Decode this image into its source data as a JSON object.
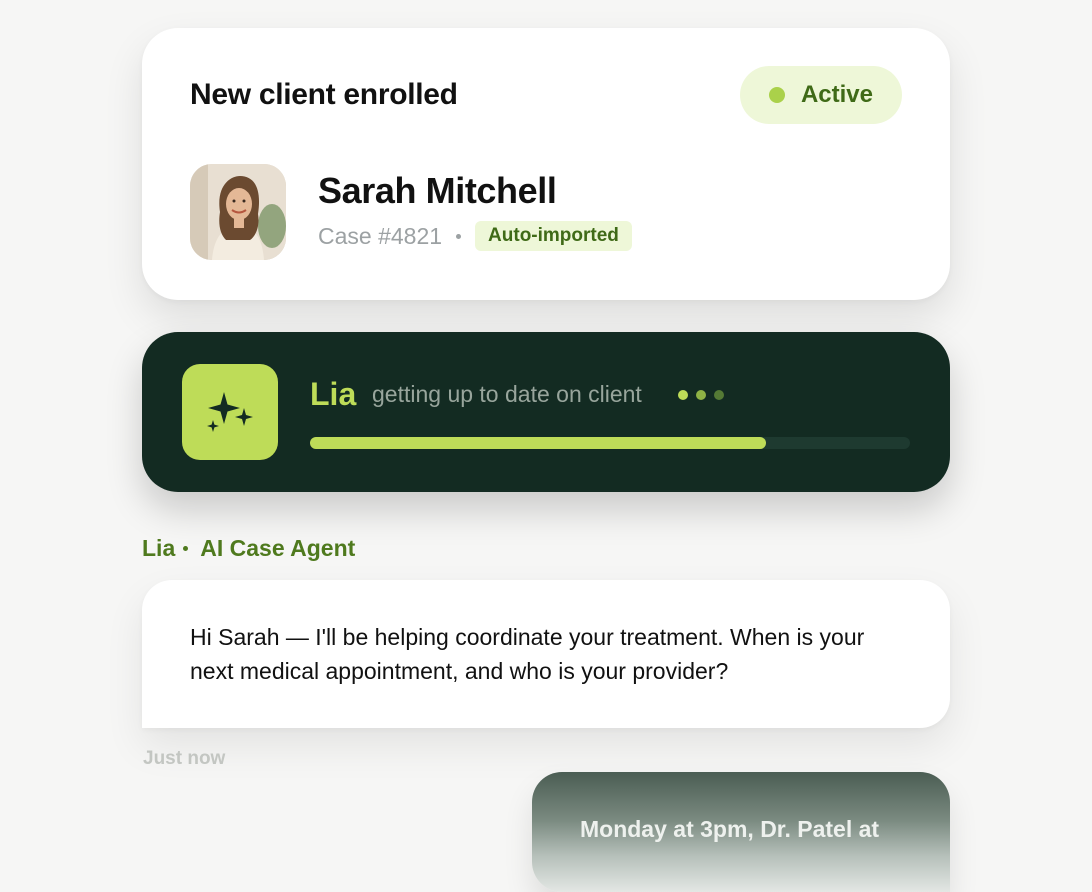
{
  "enrollment": {
    "title": "New client enrolled",
    "status_label": "Active",
    "status_color": "#aad14a"
  },
  "client": {
    "name": "Sarah Mitchell",
    "case_number": "Case #4821",
    "badge": "Auto-imported",
    "avatar_icon": "avatar-photo"
  },
  "agent": {
    "name": "Lia",
    "status_text": "getting up to date on client",
    "icon": "sparkles-icon",
    "progress_fraction": 0.76,
    "accent_color": "#bedc58",
    "background_color": "#132b22"
  },
  "conversation": {
    "sender_name": "Lia",
    "sender_role": "AI Case Agent",
    "message": "Hi Sarah — I'll be helping coordinate your treatment. When is your next medical appointment, and who is your provider?",
    "timestamp": "Just now",
    "reply_preview": "Monday at 3pm, Dr. Patel at"
  }
}
